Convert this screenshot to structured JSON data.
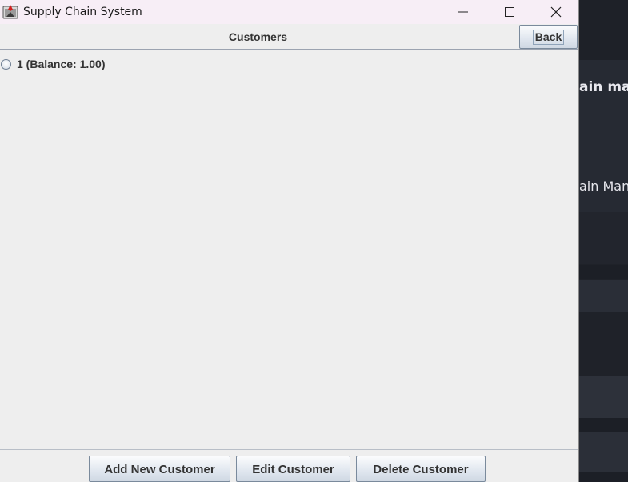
{
  "window": {
    "title": "Supply Chain System",
    "controls": [
      "minimize",
      "maximize",
      "close"
    ]
  },
  "header": {
    "title": "Customers",
    "back_label": "Back"
  },
  "customers": [
    {
      "label": "1 (Balance: 1.00)",
      "selected": false
    }
  ],
  "actions": {
    "add_label": "Add New Customer",
    "edit_label": "Edit Customer",
    "delete_label": "Delete Customer"
  },
  "background_app": {
    "heading_fragment": "ain man",
    "subheading_fragment": "ain Mana"
  }
}
